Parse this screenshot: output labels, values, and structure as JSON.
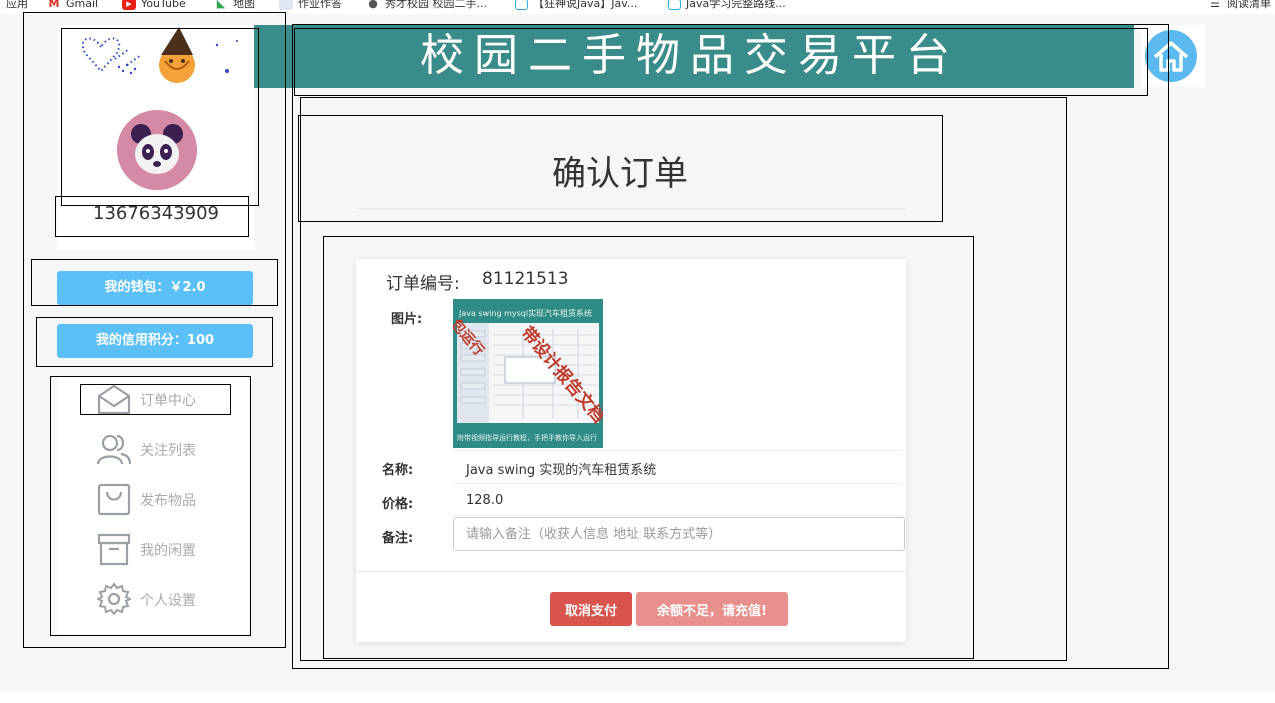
{
  "bookmarks": [
    {
      "label": "应用",
      "icon": "apps-icon"
    },
    {
      "label": "Gmail",
      "icon": "gmail-icon"
    },
    {
      "label": "YouTube",
      "icon": "youtube-icon"
    },
    {
      "label": "地图",
      "icon": "maps-icon"
    },
    {
      "label": "作业作答",
      "icon": "folder-icon"
    },
    {
      "label": "秀才校园 校园二手...",
      "icon": "globe-icon"
    },
    {
      "label": "【狂神说Java】Jav...",
      "icon": "bilibili-icon"
    },
    {
      "label": "Java学习完整路线...",
      "icon": "bilibili-icon"
    },
    {
      "label": "阅读清单",
      "icon": "reading-list-icon"
    }
  ],
  "header": {
    "title": "校园二手物品交易平台",
    "home_icon": "home-icon",
    "banner_color": "#3a8c8a"
  },
  "sidebar": {
    "phone": "13676343909",
    "wallet_label": "我的钱包：￥2.0",
    "credit_label": "我的信用积分：100",
    "menu": [
      {
        "label": "订单中心",
        "icon": "envelope-open-icon"
      },
      {
        "label": "关注列表",
        "icon": "users-icon"
      },
      {
        "label": "发布物品",
        "icon": "shopping-bag-icon"
      },
      {
        "label": "我的闲置",
        "icon": "archive-box-icon"
      },
      {
        "label": "个人设置",
        "icon": "gear-icon"
      }
    ]
  },
  "page": {
    "title": "确认订单"
  },
  "order": {
    "number_label": "订单编号:",
    "number": "81121513",
    "image_label": "图片:",
    "thumb_caption_top": "Java swing mysql实现汽车租赁系统",
    "thumb_overlay": "带设计报告文档",
    "thumb_overlay_left": "包运行",
    "thumb_caption_bottom": "附带视频指导运行教程，手把手教你导入运行",
    "name_label": "名称:",
    "name": "Java swing 实现的汽车租赁系统",
    "price_label": "价格:",
    "price": "128.0",
    "note_label": "备注:",
    "note_placeholder": "请输入备注（收获人信息 地址 联系方式等）",
    "note_value": ""
  },
  "actions": {
    "cancel_label": "取消支付",
    "recharge_label": "余额不足，请充值!"
  },
  "colors": {
    "accent_blue": "#5bc0f8",
    "danger": "#d9534f",
    "danger_light": "#e8908e"
  }
}
